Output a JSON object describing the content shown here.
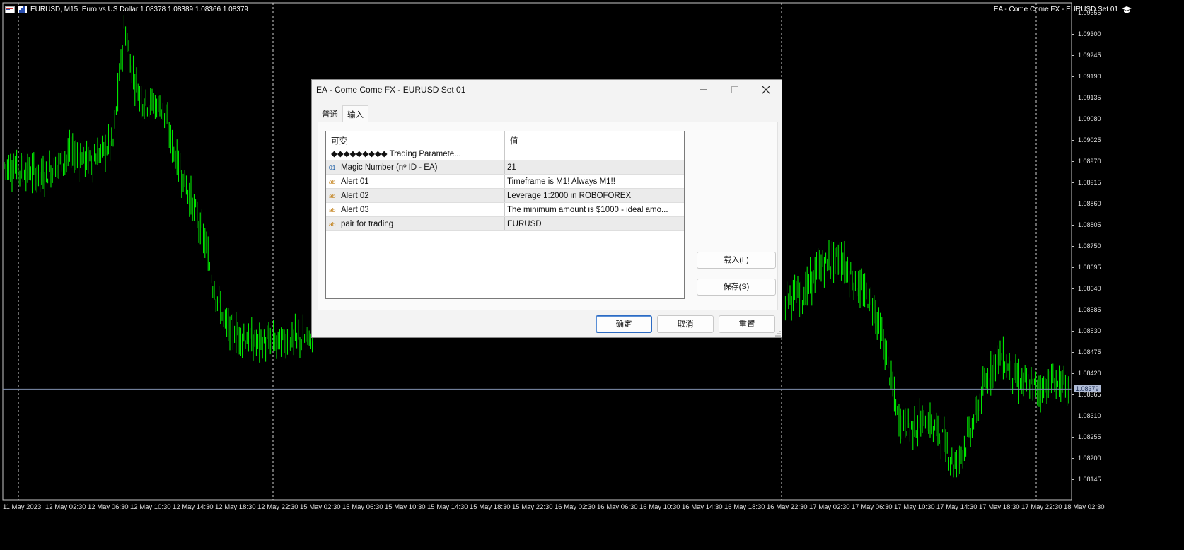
{
  "chart": {
    "symbol_info": "EURUSD, M15:  Euro vs US Dollar  1.08378 1.08389 1.08366 1.08379",
    "ea_label": "EA - Come Come FX - EURUSD Set 01",
    "current_price": "1.08379",
    "price_ticks": [
      "1.09355",
      "1.09300",
      "1.09245",
      "1.09190",
      "1.09135",
      "1.09080",
      "1.09025",
      "1.08970",
      "1.08915",
      "1.08860",
      "1.08805",
      "1.08750",
      "1.08695",
      "1.08640",
      "1.08585",
      "1.08530",
      "1.08475",
      "1.08420",
      "1.08365",
      "1.08310",
      "1.08255",
      "1.08200",
      "1.08145"
    ],
    "time_ticks": [
      "11 May 2023",
      "12 May 02:30",
      "12 May 06:30",
      "12 May 10:30",
      "12 May 14:30",
      "12 May 18:30",
      "12 May 22:30",
      "15 May 02:30",
      "15 May 06:30",
      "15 May 10:30",
      "15 May 14:30",
      "15 May 18:30",
      "15 May 22:30",
      "16 May 02:30",
      "16 May 06:30",
      "16 May 10:30",
      "16 May 14:30",
      "16 May 18:30",
      "16 May 22:30",
      "17 May 02:30",
      "17 May 06:30",
      "17 May 10:30",
      "17 May 14:30",
      "17 May 18:30",
      "17 May 22:30",
      "18 May 02:30"
    ],
    "candle_color": "#00ff00",
    "background": "#000000",
    "price_line_color": "#8090b0"
  },
  "dialog": {
    "title": "EA - Come Come FX - EURUSD Set 01",
    "tabs": [
      {
        "label": "普通"
      },
      {
        "label": "输入"
      }
    ],
    "columns": {
      "variable": "可变",
      "value": "值"
    },
    "group_label": "◆◆◆◆◆◆◆◆◆ Trading Paramete...",
    "rows": [
      {
        "type": "01",
        "name": "Magic Number (nº ID - EA)",
        "value": "21"
      },
      {
        "type": "ab",
        "name": "Alert 01",
        "value": "Timeframe is M1! Always M1!!"
      },
      {
        "type": "ab",
        "name": "Alert 02",
        "value": "Leverage 1:2000 in ROBOFOREX"
      },
      {
        "type": "ab",
        "name": "Alert 03",
        "value": "The minimum amount is $1000 - ideal amo..."
      },
      {
        "type": "ab",
        "name": "pair for trading",
        "value": "EURUSD"
      }
    ],
    "buttons": {
      "load": "载入(L)",
      "save": "保存(S)",
      "ok": "确定",
      "cancel": "取消",
      "reset": "重置"
    }
  }
}
